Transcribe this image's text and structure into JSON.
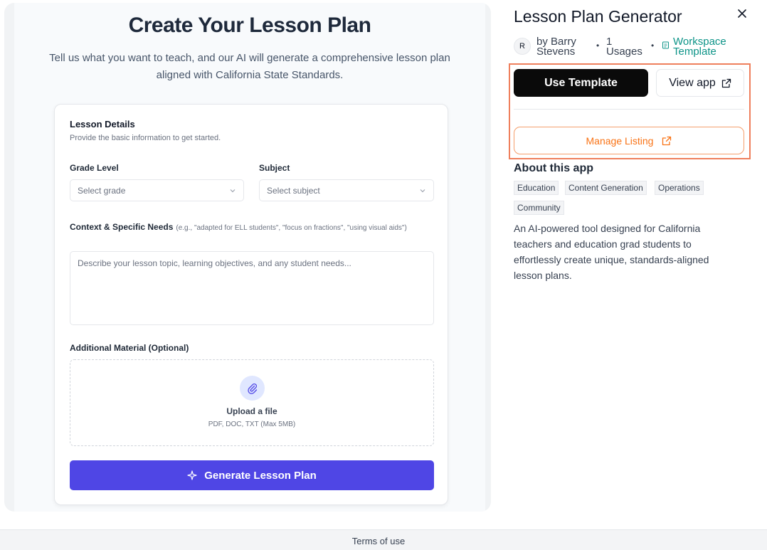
{
  "preview": {
    "title": "Create Your Lesson Plan",
    "subtitle": "Tell us what you want to teach, and our AI will generate a comprehensive lesson plan aligned with California State Standards.",
    "card": {
      "title": "Lesson Details",
      "description": "Provide the basic information to get started.",
      "grade_label": "Grade Level",
      "grade_placeholder": "Select grade",
      "subject_label": "Subject",
      "subject_placeholder": "Select subject",
      "context_label": "Context & Specific Needs",
      "context_hint": "(e.g., \"adapted for ELL students\", \"focus on fractions\", \"using visual aids\")",
      "context_placeholder": "Describe your lesson topic, learning objectives, and any student needs...",
      "material_label": "Additional Material (Optional)",
      "upload_title": "Upload a file",
      "upload_hint": "PDF, DOC, TXT (Max 5MB)",
      "generate_label": "Generate Lesson Plan"
    }
  },
  "sidebar": {
    "title": "Lesson Plan Generator",
    "avatar_initial": "R",
    "author_line1": "by Barry",
    "author_line2": "Stevens",
    "usages_line1": "1",
    "usages_line2": "Usages",
    "workspace_line1": "Workspace",
    "workspace_line2": "Template",
    "use_template_label": "Use Template",
    "view_app_label": "View app",
    "manage_listing_label": "Manage Listing",
    "about_title": "About this app",
    "tags": [
      "Education",
      "Content Generation",
      "Operations",
      "Community"
    ],
    "description": "An AI-powered tool designed for California teachers and education grad students to effortlessly create unique, standards-aligned lesson plans."
  },
  "footer": {
    "terms_label": "Terms of use"
  },
  "colors": {
    "primary_button": "#4f46e5",
    "use_template_bg": "#0a0a0a",
    "manage_listing": "#f97316",
    "workspace_link": "#0d9488",
    "highlight_border": "#ef7f5c"
  },
  "icons": [
    "chevron-down-icon",
    "paperclip-icon",
    "sparkle-icon",
    "close-icon",
    "external-link-icon",
    "template-icon"
  ]
}
